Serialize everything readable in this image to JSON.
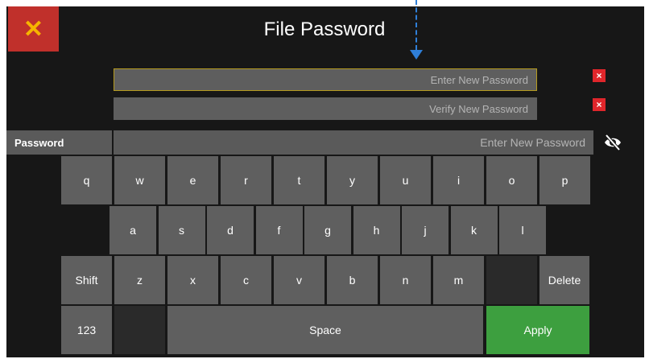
{
  "header": {
    "title": "File Password",
    "close_label": "✕"
  },
  "fields": {
    "new_password": {
      "placeholder": "Enter New Password"
    },
    "verify_password": {
      "placeholder": "Verify New Password"
    }
  },
  "input_row": {
    "label": "Password",
    "placeholder": "Enter New Password"
  },
  "keyboard": {
    "row1": [
      "q",
      "w",
      "e",
      "r",
      "t",
      "y",
      "u",
      "i",
      "o",
      "p"
    ],
    "row2": [
      "a",
      "s",
      "d",
      "f",
      "g",
      "h",
      "j",
      "k",
      "l"
    ],
    "shift": "Shift",
    "row3": [
      "z",
      "x",
      "c",
      "v",
      "b",
      "n",
      "m"
    ],
    "delete": "Delete",
    "numbers": "123",
    "space": "Space",
    "apply": "Apply"
  },
  "colors": {
    "close_button": "#c0302b",
    "close_icon": "#f6b400",
    "apply_button": "#3d9f3f",
    "error_icon": "#e0262b",
    "annotation_arrow": "#2f7fd8"
  }
}
